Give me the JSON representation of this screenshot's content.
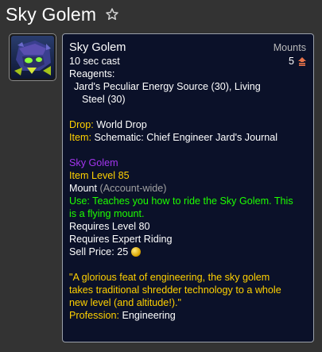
{
  "page": {
    "title": "Sky Golem"
  },
  "icons": {
    "favorite": "star-outline-icon",
    "item": "sky-golem-item-icon",
    "count": "mount-count-icon",
    "coin": "gold-coin-icon"
  },
  "colors": {
    "background": "#333333",
    "tooltip_bg": "#0b1129",
    "quality_epic": "#a335ee",
    "gold_text": "#ffd100",
    "use_green": "#1eff00",
    "count_orange": "#e8734a"
  },
  "tooltip": {
    "name": "Sky Golem",
    "type": "Mounts",
    "cast_time": "10 sec cast",
    "count": "5",
    "reagents_label": "Reagents:",
    "reagents_line1": "Jard's Peculiar Energy Source (30), Living",
    "reagents_line2": "Steel (30)",
    "drop_label": "Drop:",
    "drop_value": "World Drop",
    "item_label": "Item:",
    "item_value": "Schematic: Chief Engineer Jard's Journal",
    "item_name": "Sky Golem",
    "item_level": "Item Level 85",
    "mount_label": "Mount",
    "mount_scope": "(Account-wide)",
    "use_line1": "Use: Teaches you how to ride the Sky Golem. This",
    "use_line2": "is a flying mount.",
    "requires_level": "Requires Level 80",
    "requires_riding": "Requires Expert Riding",
    "sell_price_label": "Sell Price:",
    "sell_price_value": "25",
    "flavor_line1": "\"A glorious feat of engineering, the sky golem",
    "flavor_line2": "takes traditional shredder technology to a whole",
    "flavor_line3": "new level (and altitude!).\"",
    "profession_label": "Profession:",
    "profession_value": "Engineering"
  }
}
